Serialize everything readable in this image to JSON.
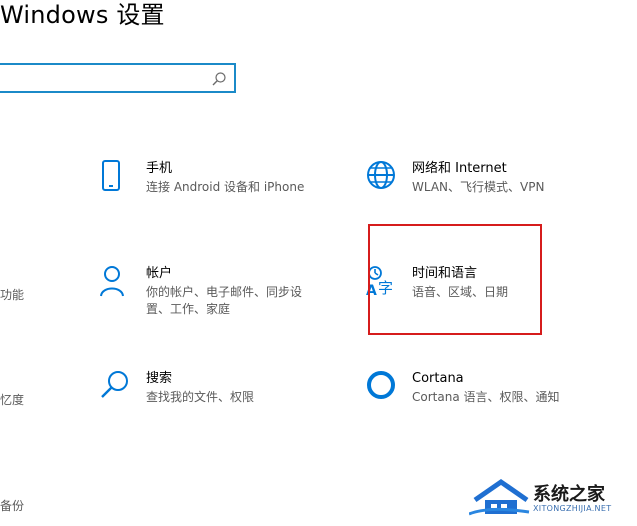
{
  "window": {
    "title": "Windows 设置"
  },
  "search": {
    "placeholder": ""
  },
  "tiles": [
    {
      "name": "手机",
      "desc": "连接 Android 设备和 iPhone",
      "icon": "phone-icon"
    },
    {
      "name": "网络和 Internet",
      "desc": "WLAN、飞行模式、VPN",
      "icon": "globe-icon"
    },
    {
      "name": "帐户",
      "desc_line1": "你的帐户、电子邮件、同步设",
      "desc_line2": "置、工作、家庭",
      "icon": "person-icon"
    },
    {
      "name": "时间和语言",
      "desc": "语音、区域、日期",
      "icon": "time-language-icon"
    },
    {
      "name": "搜索",
      "desc": "查找我的文件、权限",
      "icon": "search-icon"
    },
    {
      "name": "Cortana",
      "desc": "Cortana 语言、权限、通知",
      "icon": "cortana-icon"
    }
  ],
  "partial_left": [
    "功能",
    "忆度",
    "备份"
  ],
  "watermark": {
    "text": "系统之家",
    "sub": "XITONGZHIJIA.NET"
  },
  "colors": {
    "accent": "#0078d7",
    "highlight": "#d61c1c"
  }
}
